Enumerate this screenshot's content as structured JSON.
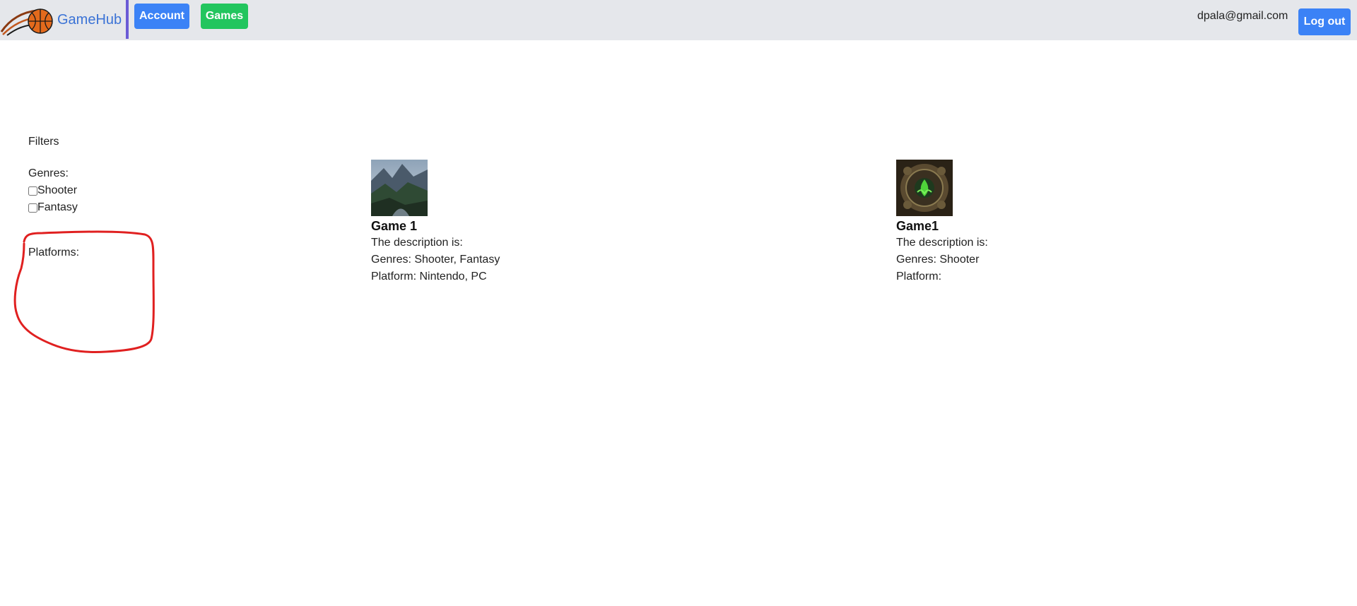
{
  "header": {
    "brand_name": "GameHub",
    "account_label": "Account",
    "games_label": "Games",
    "user_email": "dpala@gmail.com",
    "logout_label": "Log out"
  },
  "filters": {
    "title": "Filters",
    "genres_title": "Genres:",
    "genres": [
      {
        "label": "Shooter",
        "checked": false
      },
      {
        "label": "Fantasy",
        "checked": false
      }
    ],
    "platforms_title": "Platforms:"
  },
  "games": [
    {
      "title": "Game 1",
      "description": "The description is:",
      "genres": "Genres: Shooter, Fantasy",
      "platform": "Platform: Nintendo, PC",
      "thumbnail": "mountain-landscape-image"
    },
    {
      "title": "Game1",
      "description": "The description is:",
      "genres": "Genres: Shooter",
      "platform": "Platform:",
      "thumbnail": "ornate-green-emblem-image"
    }
  ],
  "colors": {
    "navbar_bg": "#e5e7eb",
    "brand_text": "#3b73d6",
    "account_button": "#3b82f6",
    "games_button": "#22c55e",
    "logout_button": "#3b82f6",
    "divider": "#6b5bd6",
    "annotation": "#e02020"
  }
}
